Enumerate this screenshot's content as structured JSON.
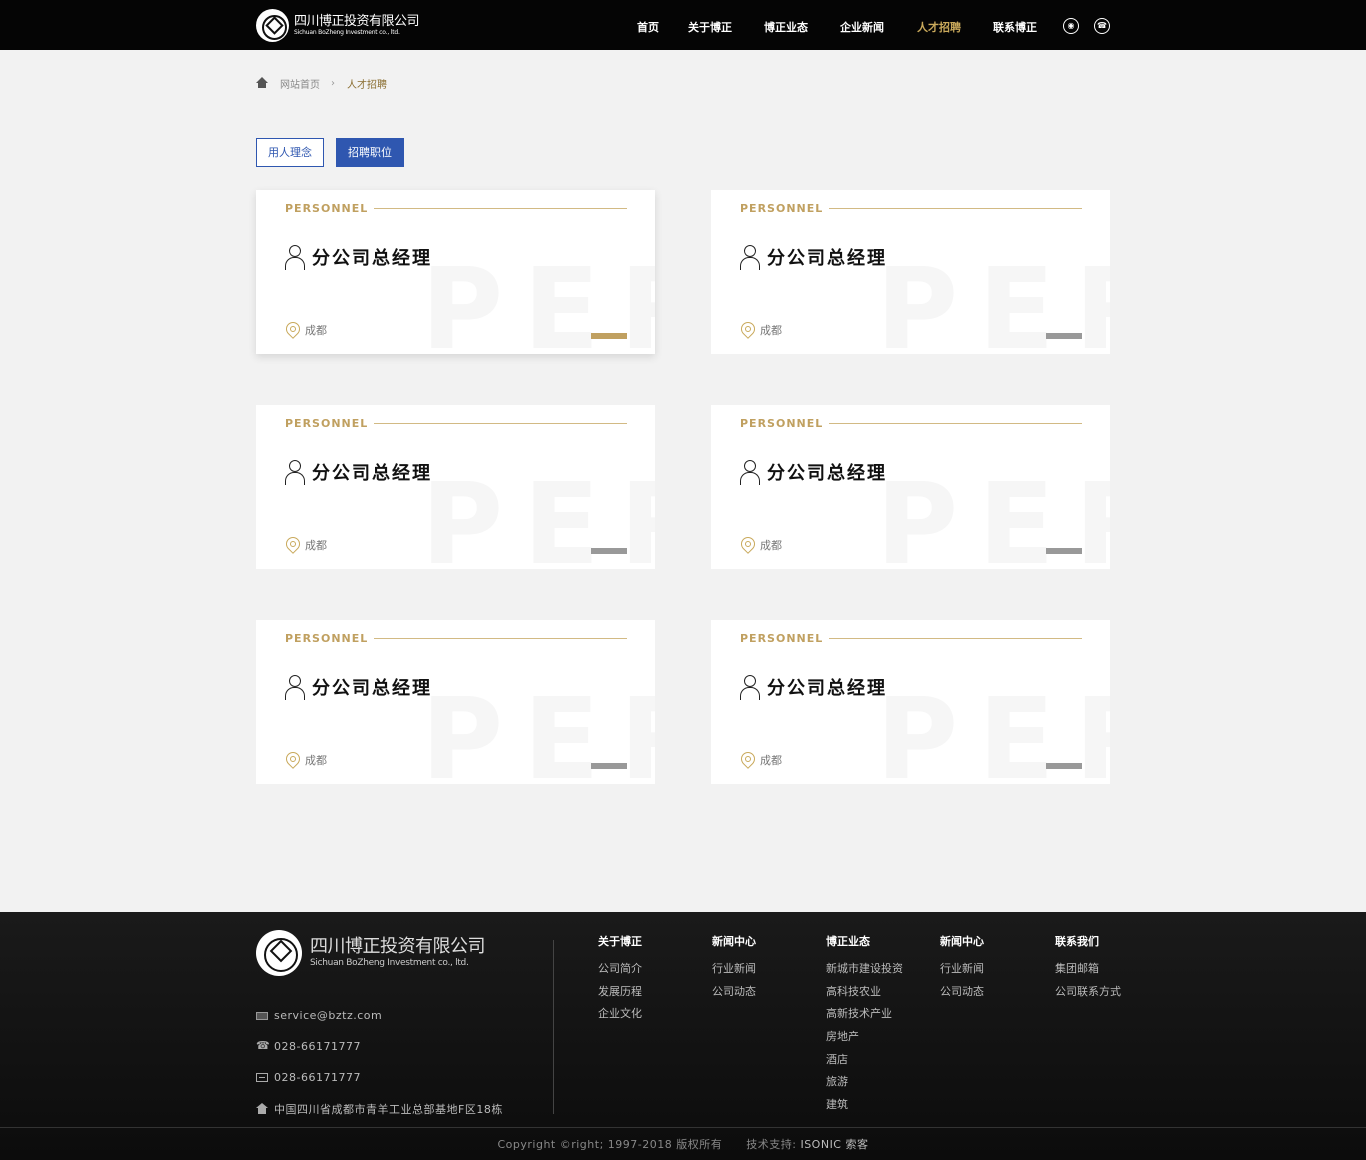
{
  "header": {
    "logo_cn": "四川博正投资有限公司",
    "logo_en": "Sichuan BoZheng Investment co., ltd.",
    "nav": [
      {
        "label": "首页",
        "active": false
      },
      {
        "label": "关于博正",
        "active": false
      },
      {
        "label": "博正业态",
        "active": false
      },
      {
        "label": "企业新闻",
        "active": false
      },
      {
        "label": "人才招聘",
        "active": true
      },
      {
        "label": "联系博正",
        "active": false
      }
    ],
    "icons": [
      "wechat-icon",
      "phone-icon"
    ]
  },
  "breadcrumb": {
    "home": "网站首页",
    "current": "人才招聘"
  },
  "tabs": [
    {
      "label": "用人理念",
      "active": false
    },
    {
      "label": "招聘职位",
      "active": true
    }
  ],
  "jobs": [
    {
      "tag": "PERSONNEL",
      "watermark": "PER",
      "title": "分公司总经理",
      "location": "成都"
    },
    {
      "tag": "PERSONNEL",
      "watermark": "PER",
      "title": "分公司总经理",
      "location": "成都"
    },
    {
      "tag": "PERSONNEL",
      "watermark": "PER",
      "title": "分公司总经理",
      "location": "成都"
    },
    {
      "tag": "PERSONNEL",
      "watermark": "PER",
      "title": "分公司总经理",
      "location": "成都"
    },
    {
      "tag": "PERSONNEL",
      "watermark": "PER",
      "title": "分公司总经理",
      "location": "成都"
    },
    {
      "tag": "PERSONNEL",
      "watermark": "PER",
      "title": "分公司总经理",
      "location": "成都"
    }
  ],
  "colors": {
    "accent_gold": "#c0a060",
    "tab_blue": "#2f57b0",
    "header_bg": "#050505"
  },
  "footer": {
    "logo_cn": "四川博正投资有限公司",
    "logo_en": "Sichuan BoZheng Investment co., ltd.",
    "email": "service@bztz.com",
    "phone": "028-66171777",
    "fax": "028-66171777",
    "address": "中国四川省成都市青羊工业总部基地F区18栋",
    "columns": [
      {
        "title": "关于博正",
        "links": [
          "公司简介",
          "发展历程",
          "企业文化"
        ]
      },
      {
        "title": "新闻中心",
        "links": [
          "行业新闻",
          "公司动态"
        ]
      },
      {
        "title": "博正业态",
        "links": [
          "新城市建设投资",
          "高科技农业",
          "高新技术产业",
          "房地产",
          "酒店",
          "旅游",
          "建筑"
        ]
      },
      {
        "title": "新闻中心",
        "links": [
          "行业新闻",
          "公司动态"
        ]
      },
      {
        "title": "联系我们",
        "links": [
          "集团邮箱",
          "公司联系方式"
        ]
      }
    ],
    "copyright": "Copyright ©right; 1997-2018 版权所有",
    "tech_label": "技术支持:",
    "tech_brand": "ISONIC 索客"
  }
}
